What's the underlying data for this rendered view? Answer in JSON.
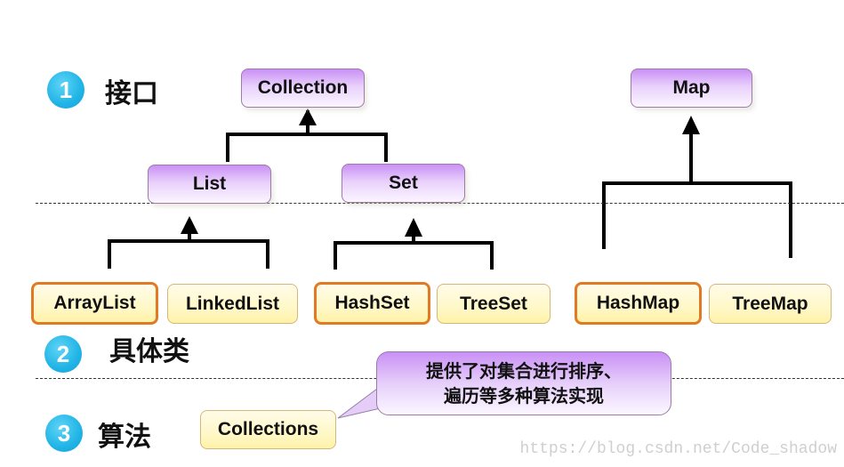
{
  "sections": [
    {
      "number": "1",
      "label": "接口"
    },
    {
      "number": "2",
      "label": "具体类"
    },
    {
      "number": "3",
      "label": "算法"
    }
  ],
  "interfaces": {
    "collection": "Collection",
    "list": "List",
    "set": "Set",
    "map": "Map"
  },
  "implementations": {
    "arraylist": "ArrayList",
    "linkedlist": "LinkedList",
    "hashset": "HashSet",
    "treeset": "TreeSet",
    "hashmap": "HashMap",
    "treemap": "TreeMap"
  },
  "algorithm": {
    "class_name": "Collections",
    "callout_line1": "提供了对集合进行排序、",
    "callout_line2": "遍历等多种算法实现"
  },
  "highlighted": [
    "ArrayList",
    "HashSet",
    "HashMap"
  ],
  "colors": {
    "interface_fill": "#c990f5",
    "implementation_fill": "#fff8c8",
    "highlight_border": "#e07a24",
    "badge": "#20b4e6"
  },
  "watermark": "https://blog.csdn.net/Code_shadow"
}
